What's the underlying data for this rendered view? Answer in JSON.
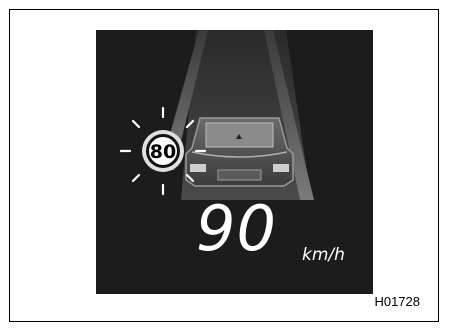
{
  "display": {
    "speed_limit": "80",
    "current_speed": "90",
    "speed_unit": "km/h",
    "sign_state": "flashing"
  },
  "figure_code": "H01728",
  "colors": {
    "display_background": "#1c1c1c",
    "sign_ring": "#e0e0e0",
    "text": "#ffffff"
  }
}
